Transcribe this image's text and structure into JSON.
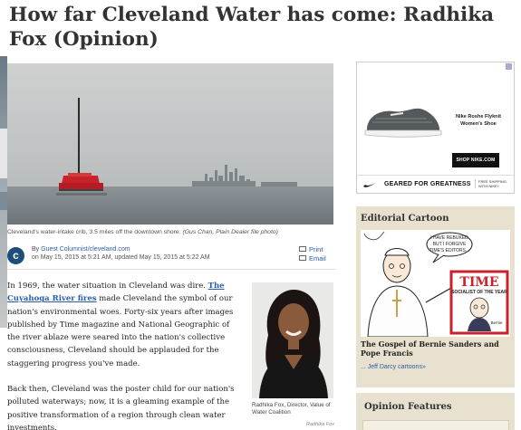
{
  "article": {
    "headline": "How far Cleveland Water has come: Radhika Fox (Opinion)",
    "photo_caption": "Cleveland's water-intake crib, 3.5 miles off the downtown shore.",
    "photo_credit": "(Gus Chan, Plain Dealer file photo)",
    "byline_prefix": "By",
    "author": "Guest Columnist/cleveland.com",
    "dateline": "on May 15, 2015 at 5:21 AM, updated May 15, 2015 at 5:22 AM",
    "print_label": "Print",
    "email_label": "Email",
    "p1_before": "In 1969, the water situation in Cleveland was dire.",
    "p1_link": "The Cuyahoga River fires",
    "p1_after": "made Cleveland the symbol of our nation's environmental woes. Forty-six years after images published by Time magazine and National Geographic of the river ablaze were seared into the nation's collective consciousness, Cleveland should be applauded for the staggering progress you've made.",
    "p2": "Back then, Cleveland was the poster child for our nation's polluted waterways; now, it is a gleaming example of the positive transformation of a region through clean water investments.",
    "portrait_caption": "Radhika Fox, Director, Value of Water Coalition",
    "portrait_credit": "Radhika Fox"
  },
  "ad": {
    "product_name": "Nike Roshe Flyknit Women's Shoe",
    "shop_button": "SHOP NIKE.COM",
    "tagline": "GEARED FOR GREATNESS",
    "shipping": "FREE SHIPPING WITH NIKE+"
  },
  "cartoon": {
    "section_title": "Editorial Cartoon",
    "speech_bubble": "I HAVE REBUKED BUT I FORGIVE TIME'S EDITORS...",
    "magazine_name": "TIME",
    "magazine_cover_text": "SOCIALIST OF THE YEAR",
    "figure_label": "Bernie",
    "title": "The Gospel of Bernie Sanders and Pope Francis",
    "more_link": "... Jeff Darcy cartoons»"
  },
  "features": {
    "section_title": "Opinion Features"
  },
  "colors": {
    "link": "#2a5da8",
    "sidebar_bg": "#e8e1cf",
    "logo_blue": "#1d4f7a",
    "crib_red": "#c8232c"
  }
}
